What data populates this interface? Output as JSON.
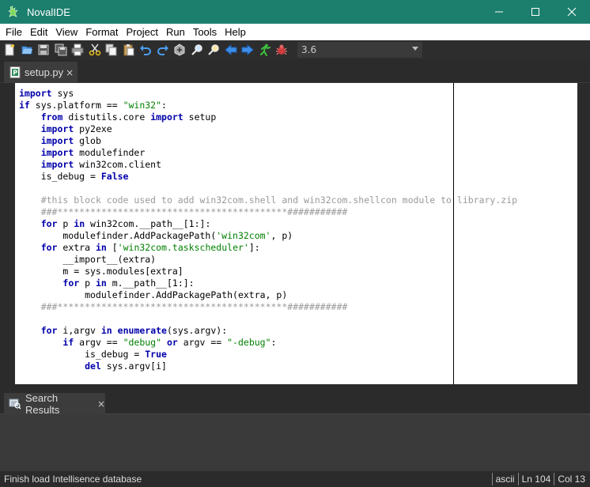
{
  "window": {
    "title": "NovalIDE",
    "controls": [
      "minimize",
      "maximize",
      "close"
    ]
  },
  "menu": [
    "File",
    "Edit",
    "View",
    "Format",
    "Project",
    "Run",
    "Tools",
    "Help"
  ],
  "toolbar": {
    "icons": [
      "new-file-icon",
      "open-file-icon",
      "save-icon",
      "save-all-icon",
      "print-icon",
      "cut-icon",
      "copy-icon",
      "paste-icon",
      "undo-icon",
      "redo-icon",
      "build-icon",
      "find-icon",
      "replace-icon",
      "back-icon",
      "forward-icon",
      "run-icon",
      "debug-icon"
    ],
    "interpreter_version": "3.6"
  },
  "editor": {
    "tab_label": "setup.py",
    "tab_close": "×",
    "lines": [
      [
        [
          "kw",
          "import"
        ],
        [
          "",
          " sys"
        ]
      ],
      [
        [
          "kw",
          "if"
        ],
        [
          "",
          " sys.platform == "
        ],
        [
          "str",
          "\"win32\""
        ],
        [
          "",
          ":"
        ]
      ],
      [
        [
          "",
          "    "
        ],
        [
          "kw",
          "from"
        ],
        [
          "",
          " distutils.core "
        ],
        [
          "kw",
          "import"
        ],
        [
          "",
          " setup"
        ]
      ],
      [
        [
          "",
          "    "
        ],
        [
          "kw",
          "import"
        ],
        [
          "",
          " py2exe"
        ]
      ],
      [
        [
          "",
          "    "
        ],
        [
          "kw",
          "import"
        ],
        [
          "",
          " glob"
        ]
      ],
      [
        [
          "",
          "    "
        ],
        [
          "kw",
          "import"
        ],
        [
          "",
          " modulefinder"
        ]
      ],
      [
        [
          "",
          "    "
        ],
        [
          "kw",
          "import"
        ],
        [
          "",
          " win32com.client"
        ]
      ],
      [
        [
          "",
          "    is_debug = "
        ],
        [
          "kw",
          "False"
        ]
      ],
      [
        [
          "",
          ""
        ]
      ],
      [
        [
          "",
          "    "
        ],
        [
          "cm",
          "#this block code used to add win32com.shell and win32com.shellcon module to library.zip"
        ]
      ],
      [
        [
          "",
          "    "
        ],
        [
          "cm",
          "###******************************************###########"
        ]
      ],
      [
        [
          "",
          "    "
        ],
        [
          "kw",
          "for"
        ],
        [
          "",
          " p "
        ],
        [
          "kw",
          "in"
        ],
        [
          "",
          " win32com.__path__[1:]:"
        ]
      ],
      [
        [
          "",
          "        modulefinder.AddPackagePath("
        ],
        [
          "str",
          "'win32com'"
        ],
        [
          "",
          ", p)"
        ]
      ],
      [
        [
          "",
          "    "
        ],
        [
          "kw",
          "for"
        ],
        [
          "",
          " extra "
        ],
        [
          "kw",
          "in"
        ],
        [
          "",
          " ["
        ],
        [
          "str",
          "'win32com.taskscheduler'"
        ],
        [
          "",
          "]:"
        ]
      ],
      [
        [
          "",
          "        __import__(extra)"
        ]
      ],
      [
        [
          "",
          "        m = sys.modules[extra]"
        ]
      ],
      [
        [
          "",
          "        "
        ],
        [
          "kw",
          "for"
        ],
        [
          "",
          " p "
        ],
        [
          "kw",
          "in"
        ],
        [
          "",
          " m.__path__[1:]:"
        ]
      ],
      [
        [
          "",
          "            modulefinder.AddPackagePath(extra, p)"
        ]
      ],
      [
        [
          "",
          "    "
        ],
        [
          "cm",
          "###******************************************###########"
        ]
      ],
      [
        [
          "",
          ""
        ]
      ],
      [
        [
          "",
          "    "
        ],
        [
          "kw",
          "for"
        ],
        [
          "",
          " i,argv "
        ],
        [
          "kw",
          "in"
        ],
        [
          "",
          " "
        ],
        [
          "kw",
          "enumerate"
        ],
        [
          "",
          "(sys.argv):"
        ]
      ],
      [
        [
          "",
          "        "
        ],
        [
          "kw",
          "if"
        ],
        [
          "",
          " argv == "
        ],
        [
          "str",
          "\"debug\""
        ],
        [
          "",
          " "
        ],
        [
          "kw",
          "or"
        ],
        [
          "",
          " argv == "
        ],
        [
          "str",
          "\"-debug\""
        ],
        [
          "",
          ":"
        ]
      ],
      [
        [
          "",
          "            is_debug = "
        ],
        [
          "kw",
          "True"
        ]
      ],
      [
        [
          "",
          "            "
        ],
        [
          "kw",
          "del"
        ],
        [
          "",
          " sys.argv[i]"
        ]
      ]
    ]
  },
  "search_panel": {
    "tab_label": "Search Results",
    "tab_close": "×"
  },
  "status": {
    "message": "Finish load Intellisence database",
    "encoding": "ascii",
    "line": "Ln 104",
    "column": "Col 13"
  },
  "colors": {
    "titlebar": "#1c7f6e",
    "keyword": "#0000aa",
    "string": "#008000",
    "comment": "#9a9a9a"
  }
}
